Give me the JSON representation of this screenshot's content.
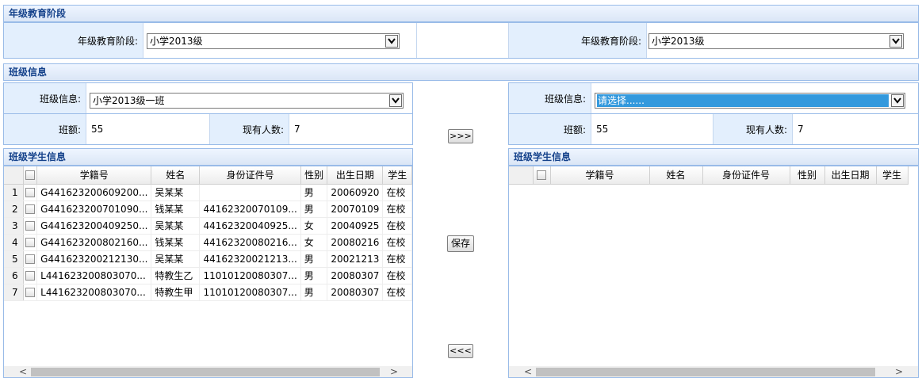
{
  "grade_panel": {
    "title": "年级教育阶段",
    "left": {
      "label": "年级教育阶段:",
      "value": "小学2013级"
    },
    "right": {
      "label": "年级教育阶段:",
      "value": "小学2013级"
    }
  },
  "class_panel": {
    "title": "班级信息",
    "left": {
      "class_label": "班级信息:",
      "class_value": "小学2013级一班",
      "quota_label": "班额:",
      "quota_value": "55",
      "current_label": "现有人数:",
      "current_value": "7"
    },
    "right": {
      "class_label": "班级信息:",
      "class_value": "请选择......",
      "quota_label": "班额:",
      "quota_value": "55",
      "current_label": "现有人数:",
      "current_value": "7"
    }
  },
  "buttons": {
    "move_right": ">>>",
    "save": "保存",
    "move_left": "<<<"
  },
  "students_left": {
    "title": "班级学生信息",
    "columns": [
      "学籍号",
      "姓名",
      "身份证件号",
      "性别",
      "出生日期",
      "学生"
    ],
    "rows": [
      {
        "n": "1",
        "sid": "G441623200609200...",
        "name": "吴某某",
        "idno": "",
        "sex": "男",
        "birth": "20060920",
        "status": "在校"
      },
      {
        "n": "2",
        "sid": "G441623200701090...",
        "name": "钱某某",
        "idno": "44162320070109...",
        "sex": "男",
        "birth": "20070109",
        "status": "在校"
      },
      {
        "n": "3",
        "sid": "G441623200409250...",
        "name": "吴某某",
        "idno": "44162320040925...",
        "sex": "女",
        "birth": "20040925",
        "status": "在校"
      },
      {
        "n": "4",
        "sid": "G441623200802160...",
        "name": "钱某某",
        "idno": "44162320080216...",
        "sex": "女",
        "birth": "20080216",
        "status": "在校"
      },
      {
        "n": "5",
        "sid": "G441623200212130...",
        "name": "吴某某",
        "idno": "44162320021213...",
        "sex": "男",
        "birth": "20021213",
        "status": "在校"
      },
      {
        "n": "6",
        "sid": "L441623200803070...",
        "name": "特教生乙",
        "idno": "11010120080307...",
        "sex": "男",
        "birth": "20080307",
        "status": "在校"
      },
      {
        "n": "7",
        "sid": "L441623200803070...",
        "name": "特教生甲",
        "idno": "11010120080307...",
        "sex": "男",
        "birth": "20080307",
        "status": "在校"
      }
    ]
  },
  "students_right": {
    "title": "班级学生信息",
    "columns": [
      "学籍号",
      "姓名",
      "身份证件号",
      "性别",
      "出生日期",
      "学生"
    ]
  },
  "scroll_arrows": {
    "left": "<",
    "right": ">"
  },
  "colors": {
    "header_text": "#15428b",
    "border": "#99bbe8",
    "label_bg": "#e3effd",
    "selection": "#3399dd"
  }
}
